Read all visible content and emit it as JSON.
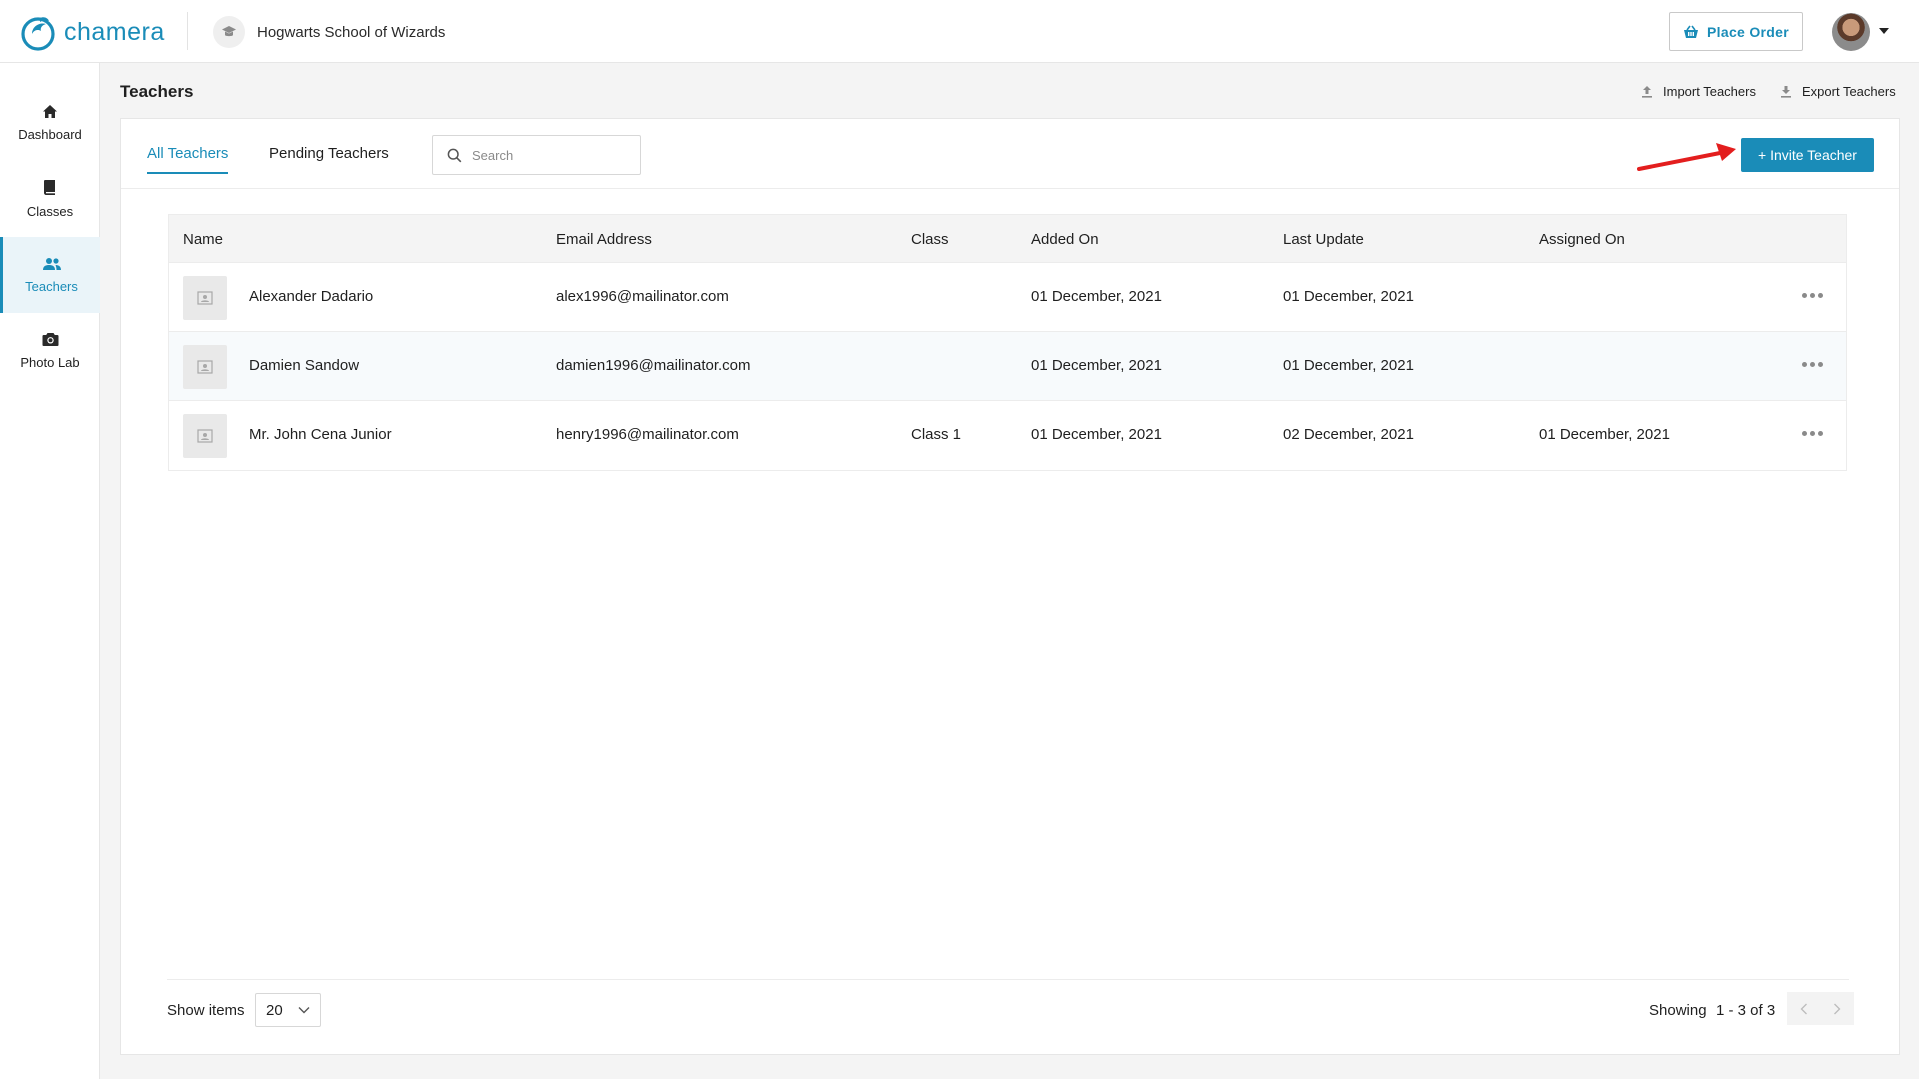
{
  "header": {
    "logo_text": "chamera",
    "school_name": "Hogwarts School of Wizards",
    "place_order_label": "Place Order"
  },
  "sidebar": {
    "items": [
      {
        "label": "Dashboard",
        "icon": "home-icon"
      },
      {
        "label": "Classes",
        "icon": "book-icon"
      },
      {
        "label": "Teachers",
        "icon": "users-icon",
        "active": true
      },
      {
        "label": "Photo Lab",
        "icon": "camera-icon"
      }
    ]
  },
  "page": {
    "title": "Teachers",
    "import_label": "Import Teachers",
    "export_label": "Export Teachers"
  },
  "tabs": [
    {
      "label": "All Teachers",
      "active": true
    },
    {
      "label": "Pending Teachers",
      "active": false
    }
  ],
  "search": {
    "placeholder": "Search",
    "value": ""
  },
  "invite_button_label": "+ Invite Teacher",
  "table": {
    "headers": [
      "Name",
      "Email Address",
      "Class",
      "Added On",
      "Last Update",
      "Assigned On"
    ],
    "rows": [
      {
        "name": "Alexander Dadario",
        "email": "alex1996@mailinator.com",
        "class": "",
        "added_on": "01 December, 2021",
        "last_update": "01 December, 2021",
        "assigned_on": ""
      },
      {
        "name": "Damien Sandow",
        "email": "damien1996@mailinator.com",
        "class": "",
        "added_on": "01 December, 2021",
        "last_update": "01 December, 2021",
        "assigned_on": ""
      },
      {
        "name": "Mr. John Cena Junior",
        "email": "henry1996@mailinator.com",
        "class": "Class 1",
        "added_on": "01 December, 2021",
        "last_update": "02 December, 2021",
        "assigned_on": "01 December, 2021"
      }
    ]
  },
  "footer": {
    "show_items_label": "Show items",
    "items_per_page": "20",
    "showing_label": "Showing",
    "showing_range": "1 - 3 of 3"
  },
  "colors": {
    "accent": "#1a8cb8",
    "annotation_arrow": "#e31e1e"
  }
}
